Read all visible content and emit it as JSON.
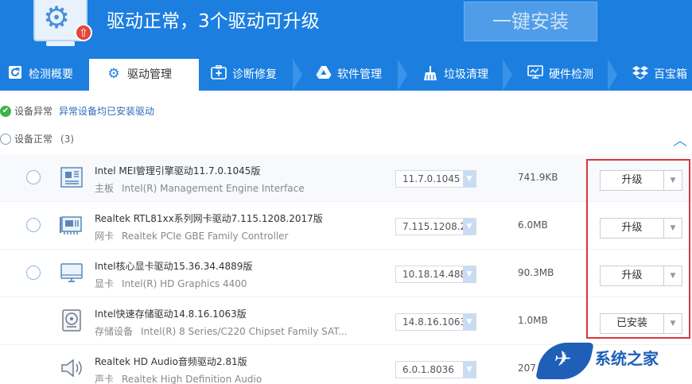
{
  "header": {
    "title": "驱动正常，3个驱动可升级",
    "install_button": "一键安装"
  },
  "tabs": [
    {
      "label": "检测概要",
      "icon": "refresh-icon"
    },
    {
      "label": "驱动管理",
      "icon": "gear-icon",
      "active": true
    },
    {
      "label": "诊断修复",
      "icon": "medical-kit-icon"
    },
    {
      "label": "软件管理",
      "icon": "drive-triangle-icon"
    },
    {
      "label": "垃圾清理",
      "icon": "broom-icon"
    },
    {
      "label": "硬件检测",
      "icon": "monitor-icon"
    },
    {
      "label": "百宝箱",
      "icon": "box-icon"
    }
  ],
  "status": {
    "abnormal_label": "设备异常",
    "abnormal_info": "异常设备均已安装驱动",
    "normal_label": "设备正常",
    "normal_count": "(3)"
  },
  "drivers": [
    {
      "name": "Intel MEI管理引擎驱动11.7.0.1045版",
      "category": "主板",
      "device": "Intel(R) Management Engine Interface",
      "version": "11.7.0.1045",
      "size": "741.9KB",
      "action": "升级",
      "icon": "motherboard-icon"
    },
    {
      "name": "Realtek RTL81xx系列网卡驱动7.115.1208.2017版",
      "category": "网卡",
      "device": "Realtek PCIe GBE Family Controller",
      "version": "7.115.1208.2",
      "size": "6.0MB",
      "action": "升级",
      "icon": "network-card-icon"
    },
    {
      "name": "Intel核心显卡驱动15.36.34.4889版",
      "category": "显卡",
      "device": "Intel(R) HD Graphics 4400",
      "version": "10.18.14.488",
      "size": "90.3MB",
      "action": "升级",
      "icon": "display-icon"
    },
    {
      "name": "Intel快速存储驱动14.8.16.1063版",
      "category": "存储设备",
      "device": "Intel(R) 8 Series/C220 Chipset Family SAT...",
      "version": "14.8.16.1063",
      "size": "1.0MB",
      "action": "已安装",
      "icon": "hard-disk-icon"
    },
    {
      "name": "Realtek HD Audio音频驱动2.81版",
      "category": "声卡",
      "device": "Realtek High Definition Audio",
      "version": "6.0.1.8036",
      "size": "207",
      "action": "",
      "icon": "speaker-icon"
    }
  ],
  "watermark": {
    "text": "系统之家"
  }
}
